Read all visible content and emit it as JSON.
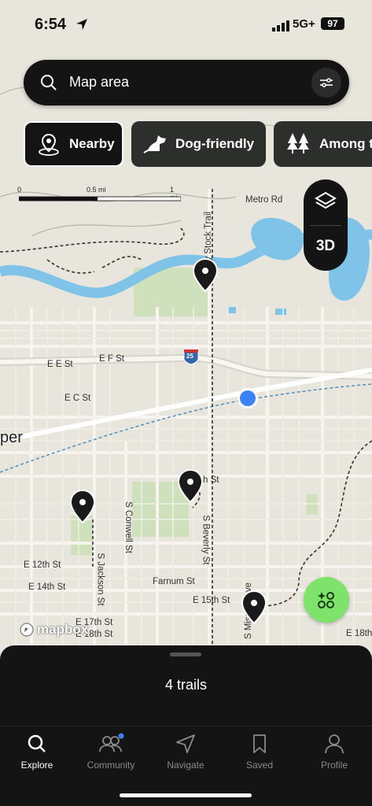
{
  "status_bar": {
    "time": "6:54",
    "network": "5G+",
    "battery": "97"
  },
  "search": {
    "placeholder": "Map area"
  },
  "chips": [
    {
      "label": "Nearby",
      "icon": "location-pin-icon",
      "active": true
    },
    {
      "label": "Dog-friendly",
      "icon": "dog-icon",
      "active": false
    },
    {
      "label": "Among t",
      "icon": "trees-icon",
      "active": false
    }
  ],
  "scale_bar": {
    "start": "0",
    "mid": "0.5 mi",
    "end": "1 mi"
  },
  "map_controls": {
    "layers_icon": "layers-icon",
    "three_d": "3D"
  },
  "map_labels": {
    "metro_rd": "Metro Rd",
    "bry_stock_trail": "Bry Stock Trail",
    "interstate": "25",
    "e_e_st": "E E St",
    "e_f_st": "E F St",
    "e_c_st": "E C St",
    "city_partial": "per",
    "h_st_partial": "h St",
    "s_conwell": "S Conwell St",
    "s_beverly": "S Beverly St",
    "s_jackson": "S Jackson St",
    "e_12th": "E 12th St",
    "e_14th": "E 14th St",
    "farnum": "Farnum St",
    "e_15th": "E 15th St",
    "s_mission": "S Mission Ave",
    "e_17th": "E 17th St",
    "e_18th": "E 18th St",
    "e_18th_right": "E 18th"
  },
  "attribution": "mapbox",
  "sheet": {
    "title": "4 trails"
  },
  "tabs": [
    {
      "label": "Explore",
      "icon": "search-icon",
      "active": true
    },
    {
      "label": "Community",
      "icon": "people-icon",
      "active": false
    },
    {
      "label": "Navigate",
      "icon": "navigate-arrow-icon",
      "active": false
    },
    {
      "label": "Saved",
      "icon": "bookmark-icon",
      "active": false
    },
    {
      "label": "Profile",
      "icon": "person-icon",
      "active": false
    }
  ],
  "colors": {
    "accent_green": "#7ee36b",
    "water": "#7fc3e8",
    "park": "#c9dcb4",
    "user_location": "#3b82f6"
  }
}
